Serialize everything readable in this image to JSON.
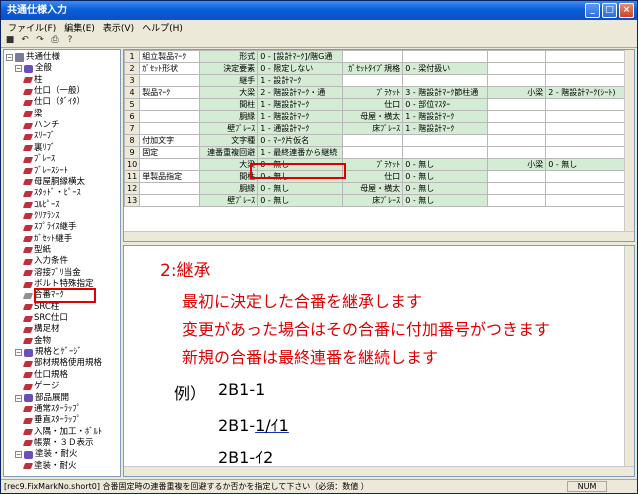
{
  "window": {
    "title": "共通仕様入力"
  },
  "menu": [
    "ファイル(F)",
    "編集(E)",
    "表示(V)",
    "ヘルプ(H)"
  ],
  "tree": [
    {
      "label": "共通仕様",
      "indent": 0,
      "kind": "root",
      "exp": "−"
    },
    {
      "label": "全般",
      "indent": 1,
      "kind": "folder",
      "exp": "−"
    },
    {
      "label": "柱",
      "indent": 2,
      "kind": "item"
    },
    {
      "label": "仕口（一般）",
      "indent": 2,
      "kind": "item"
    },
    {
      "label": "仕口（ﾀﾞｲﾀ）",
      "indent": 2,
      "kind": "item"
    },
    {
      "label": "梁",
      "indent": 2,
      "kind": "item"
    },
    {
      "label": "ハンチ",
      "indent": 2,
      "kind": "item"
    },
    {
      "label": "ｽﾘｰﾌﾞ",
      "indent": 2,
      "kind": "item"
    },
    {
      "label": "裏ﾘﾌﾞ",
      "indent": 2,
      "kind": "item"
    },
    {
      "label": "ﾌﾞﾚｰｽ",
      "indent": 2,
      "kind": "item"
    },
    {
      "label": "ﾌﾞﾚｰｽｼｰﾄ",
      "indent": 2,
      "kind": "item"
    },
    {
      "label": "母屋胴縁横太",
      "indent": 2,
      "kind": "item"
    },
    {
      "label": "ｽﾀｯﾄﾞ・ﾋﾟｰｽ",
      "indent": 2,
      "kind": "item"
    },
    {
      "label": "ｺﾙﾋﾟｰｽ",
      "indent": 2,
      "kind": "item"
    },
    {
      "label": "ｸﾘｱﾗﾝｽ",
      "indent": 2,
      "kind": "item"
    },
    {
      "label": "ｽﾌﾟﾗｲｽ継手",
      "indent": 2,
      "kind": "item"
    },
    {
      "label": "ｶﾞｾｯﾄ継手",
      "indent": 2,
      "kind": "item"
    },
    {
      "label": "型紙",
      "indent": 2,
      "kind": "item"
    },
    {
      "label": "入力条件",
      "indent": 2,
      "kind": "item"
    },
    {
      "label": "溶接ﾌﾞﾘ当金",
      "indent": 2,
      "kind": "item"
    },
    {
      "label": "ボルト特殊指定",
      "indent": 2,
      "kind": "item"
    },
    {
      "label": "合番ﾏｰｸ",
      "indent": 2,
      "kind": "item",
      "selected": true
    },
    {
      "label": "SRC柱",
      "indent": 2,
      "kind": "item"
    },
    {
      "label": "SRC仕口",
      "indent": 2,
      "kind": "item"
    },
    {
      "label": "構足材",
      "indent": 2,
      "kind": "item"
    },
    {
      "label": "金物",
      "indent": 2,
      "kind": "item"
    },
    {
      "label": "規格とｹﾞｰｼﾞ",
      "indent": 1,
      "kind": "folder",
      "exp": "−"
    },
    {
      "label": "部材規格使用規格",
      "indent": 2,
      "kind": "item"
    },
    {
      "label": "仕口規格",
      "indent": 2,
      "kind": "item"
    },
    {
      "label": "ゲージ",
      "indent": 2,
      "kind": "item"
    },
    {
      "label": "部品展開",
      "indent": 1,
      "kind": "folder",
      "exp": "−"
    },
    {
      "label": "通常ｽﾀｰﾗｯﾌﾟ",
      "indent": 2,
      "kind": "item"
    },
    {
      "label": "垂直ｽﾀｰﾗｯﾌﾟ",
      "indent": 2,
      "kind": "item"
    },
    {
      "label": "入隅・加工・ﾎﾞﾙﾄ",
      "indent": 2,
      "kind": "item"
    },
    {
      "label": "帳票・３Ｄ表示",
      "indent": 2,
      "kind": "item"
    },
    {
      "label": "塗装・耐火",
      "indent": 1,
      "kind": "folder",
      "exp": "−"
    },
    {
      "label": "塗装・耐火",
      "indent": 2,
      "kind": "item"
    }
  ],
  "grid": {
    "rows": [
      {
        "n": "1",
        "cat": "組立製品ﾏｰｸ",
        "c": [
          [
            "形式",
            "0 - [設計ﾏｰｸ]/階G通"
          ],
          [
            "",
            ""
          ],
          [
            "",
            ""
          ]
        ]
      },
      {
        "n": "2",
        "cat": "ｶﾞｾｯﾄ形状",
        "c": [
          [
            "決定要素",
            "0 - 限定しない"
          ],
          [
            "ｶﾞｾｯﾄﾀｲﾌﾟ規格",
            "0 - 梁付扱い"
          ],
          [
            "",
            ""
          ]
        ]
      },
      {
        "n": "3",
        "cat": "",
        "c": [
          [
            "継手",
            "1 - 設計ﾏｰｸ"
          ],
          [
            "",
            ""
          ],
          [
            "",
            ""
          ]
        ]
      },
      {
        "n": "4",
        "cat": "製品ﾏｰｸ",
        "c": [
          [
            "大梁",
            "2 - 階設計ﾏｰｸ・通"
          ],
          [
            "ﾌﾞﾗｹｯﾄ",
            "3 - 階設計ﾏｰｸ節柱通"
          ],
          [
            "小梁",
            "2 - 階設計ﾏｰｸ(ｼｰﾄ)"
          ]
        ]
      },
      {
        "n": "5",
        "cat": "",
        "c": [
          [
            "間柱",
            "1 - 階設計ﾏｰｸ"
          ],
          [
            "仕口",
            "0 - 部位ﾏｽﾀｰ"
          ],
          [
            "",
            ""
          ]
        ]
      },
      {
        "n": "6",
        "cat": "",
        "c": [
          [
            "胴縁",
            "1 - 階設計ﾏｰｸ"
          ],
          [
            "母屋・横太",
            "1 - 階設計ﾏｰｸ"
          ],
          [
            "",
            ""
          ]
        ]
      },
      {
        "n": "7",
        "cat": "",
        "c": [
          [
            "壁ﾌﾞﾚｰｽ",
            "1 - 通設計ﾏｰｸ"
          ],
          [
            "床ﾌﾞﾚｰｽ",
            "1 - 階設計ﾏｰｸ"
          ],
          [
            "",
            ""
          ]
        ]
      },
      {
        "n": "8",
        "cat": "付加文字",
        "c": [
          [
            "文字種",
            "0 - ﾏｰｸ片仮名"
          ],
          [
            "",
            ""
          ],
          [
            "",
            ""
          ]
        ]
      },
      {
        "n": "9",
        "cat": "固定",
        "c": [
          [
            "連番重複回避",
            "1 - 最終連番から継続"
          ],
          [
            "",
            ""
          ],
          [
            "",
            ""
          ]
        ]
      },
      {
        "n": "10",
        "cat": "",
        "c": [
          [
            "大梁",
            "0 - 無し"
          ],
          [
            "ﾌﾞﾗｹｯﾄ",
            "0 - 無し"
          ],
          [
            "小梁",
            "0 - 無し"
          ]
        ]
      },
      {
        "n": "11",
        "cat": "単製品指定",
        "c": [
          [
            "間柱",
            "0 - 無し"
          ],
          [
            "仕口",
            "0 - 無し"
          ],
          [
            "",
            ""
          ]
        ]
      },
      {
        "n": "12",
        "cat": "",
        "c": [
          [
            "胴縁",
            "0 - 無し"
          ],
          [
            "母屋・横太",
            "0 - 無し"
          ],
          [
            "",
            ""
          ]
        ]
      },
      {
        "n": "13",
        "cat": "",
        "c": [
          [
            "壁ﾌﾞﾚｰｽ",
            "0 - 無し"
          ],
          [
            "床ﾌﾞﾚｰｽ",
            "0 - 無し"
          ],
          [
            "",
            ""
          ]
        ]
      }
    ]
  },
  "description": {
    "title": "2:継承",
    "lines": [
      "最初に決定した合番を継承します",
      "変更があった場合はその合番に付加番号がつきます",
      "新規の合番は最終連番を継続します"
    ],
    "example_label": "例）",
    "example_1": "2B1-1",
    "example_2_prefix": "2B1-",
    "example_2_underlined": "1/ｲ1",
    "example_3": "2B1-ｲ2"
  },
  "status": {
    "text": "[rec9.FixMarkNo.short0] 合番固定時の連番重複を回避するか否かを指定して下さい（必須：数値 ）",
    "num": "NUM"
  }
}
